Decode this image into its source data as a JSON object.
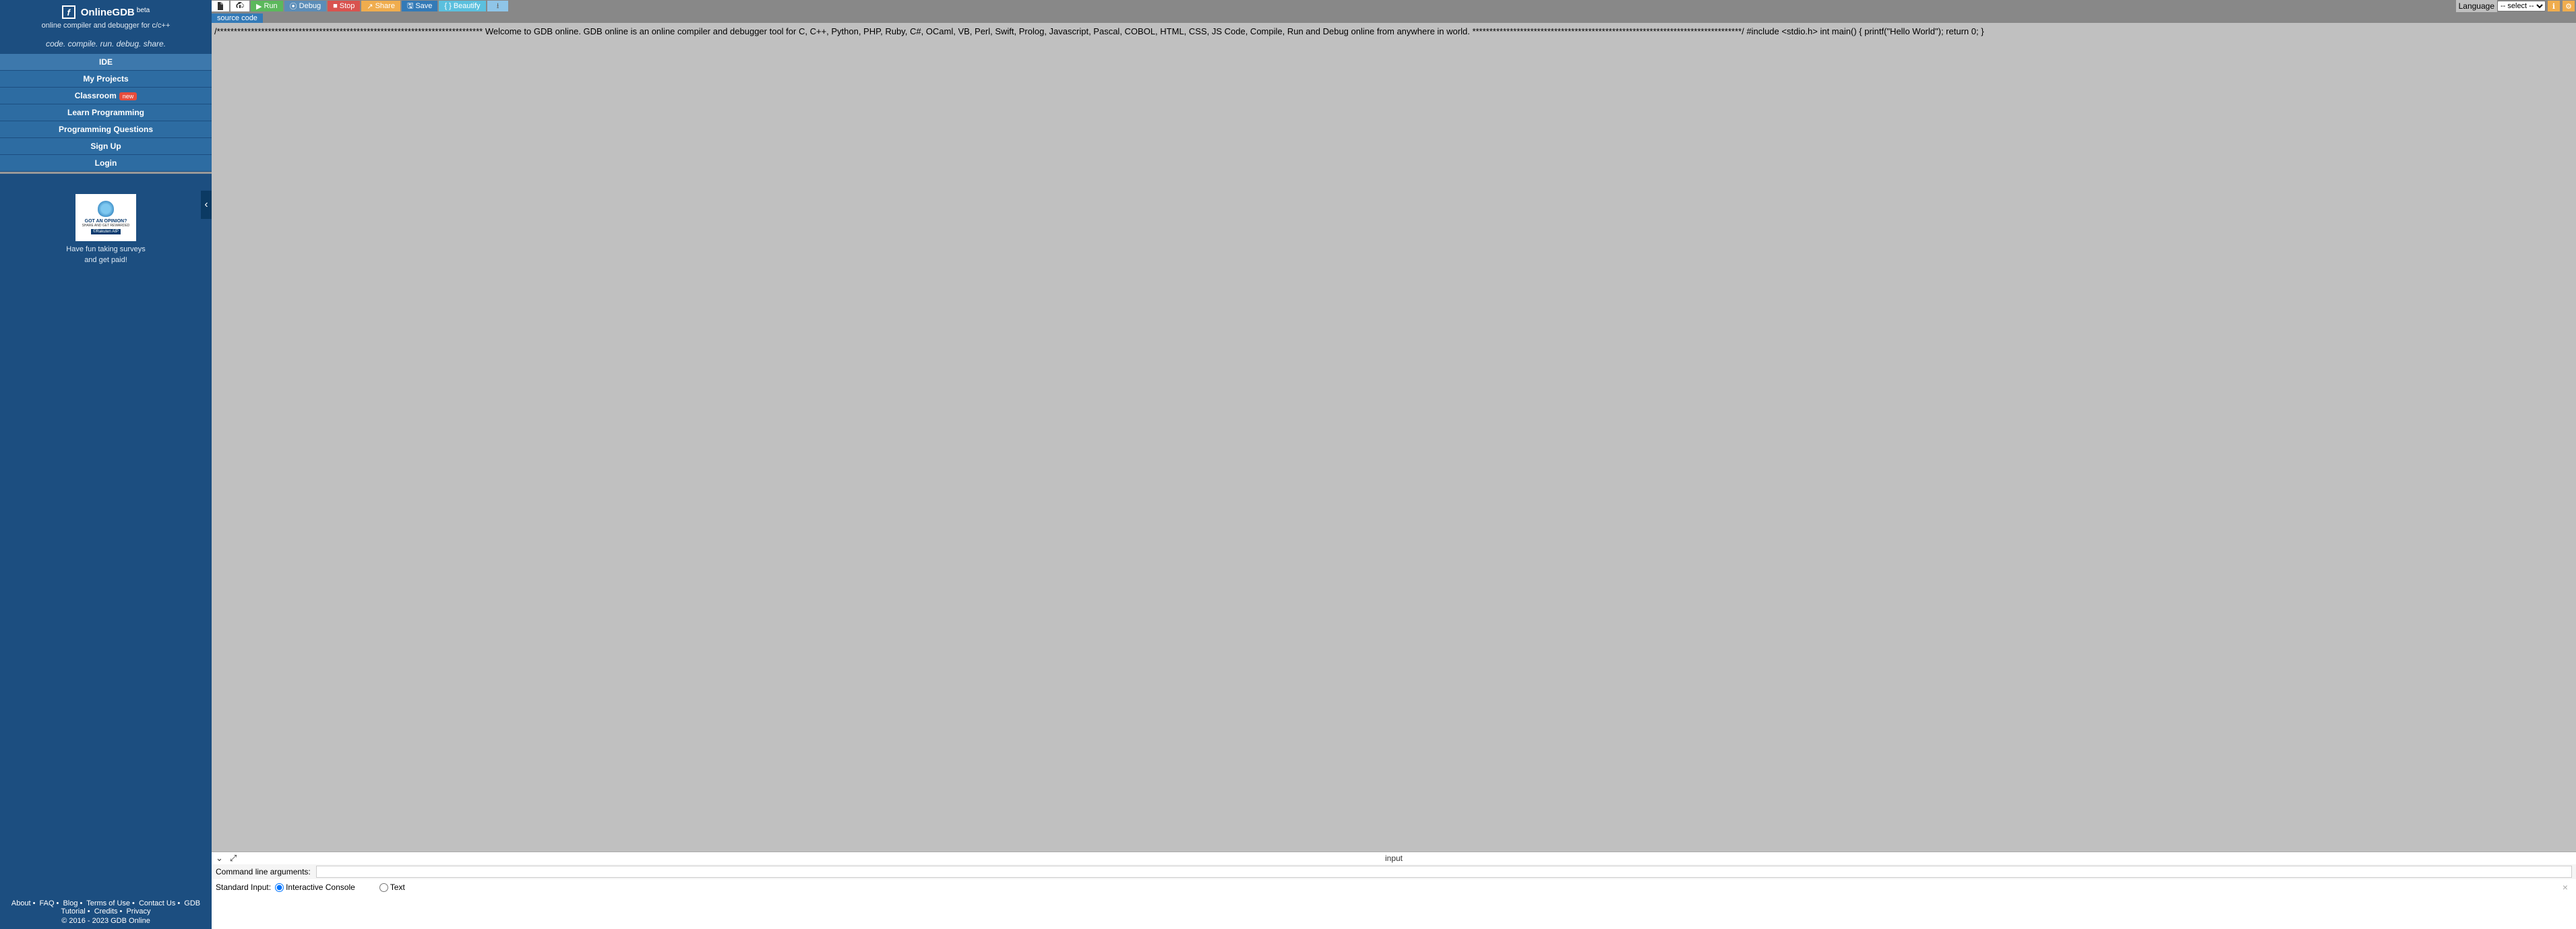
{
  "brand": {
    "name": "OnlineGDB",
    "badge": "beta",
    "tagline": "online compiler and debugger for c/c++",
    "motto": "code. compile. run. debug. share."
  },
  "nav": {
    "items": [
      {
        "label": "IDE"
      },
      {
        "label": "My Projects"
      },
      {
        "label": "Classroom",
        "badge": "new"
      },
      {
        "label": "Learn Programming"
      },
      {
        "label": "Programming Questions"
      },
      {
        "label": "Sign Up"
      },
      {
        "label": "Login"
      }
    ]
  },
  "ad": {
    "line1": "GOT AN OPINION?",
    "line2": "SHARE AND GET REWARDED",
    "line3": "©Rakuten AIP",
    "caption1": "Have fun taking surveys",
    "caption2": "and get paid!"
  },
  "footer": {
    "links": [
      "About",
      "FAQ",
      "Blog",
      "Terms of Use",
      "Contact Us",
      "GDB Tutorial",
      "Credits",
      "Privacy"
    ],
    "copyright": "© 2016 - 2023 GDB Online"
  },
  "toolbar": {
    "run": "Run",
    "debug": "Debug",
    "stop": "Stop",
    "share": "Share",
    "save": "Save",
    "beautify": "Beautify",
    "languageLabel": "Language",
    "languagePlaceholder": "-- select --"
  },
  "tab": {
    "label": "source code"
  },
  "editor": {
    "text": "/****************************************************************************** Welcome to GDB online. GDB online is an online compiler and debugger tool for C, C++, Python, PHP, Ruby, C#, OCaml, VB, Perl, Swift, Prolog, Javascript, Pascal, COBOL, HTML, CSS, JS Code, Compile, Run and Debug online from anywhere in world. *******************************************************************************/ #include <stdio.h> int main() { printf(\"Hello World\"); return 0; }"
  },
  "inputPanel": {
    "title": "input",
    "argsLabel": "Command line arguments:",
    "argsValue": "",
    "stdinLabel": "Standard Input:",
    "optInteractive": "Interactive Console",
    "optText": "Text"
  }
}
